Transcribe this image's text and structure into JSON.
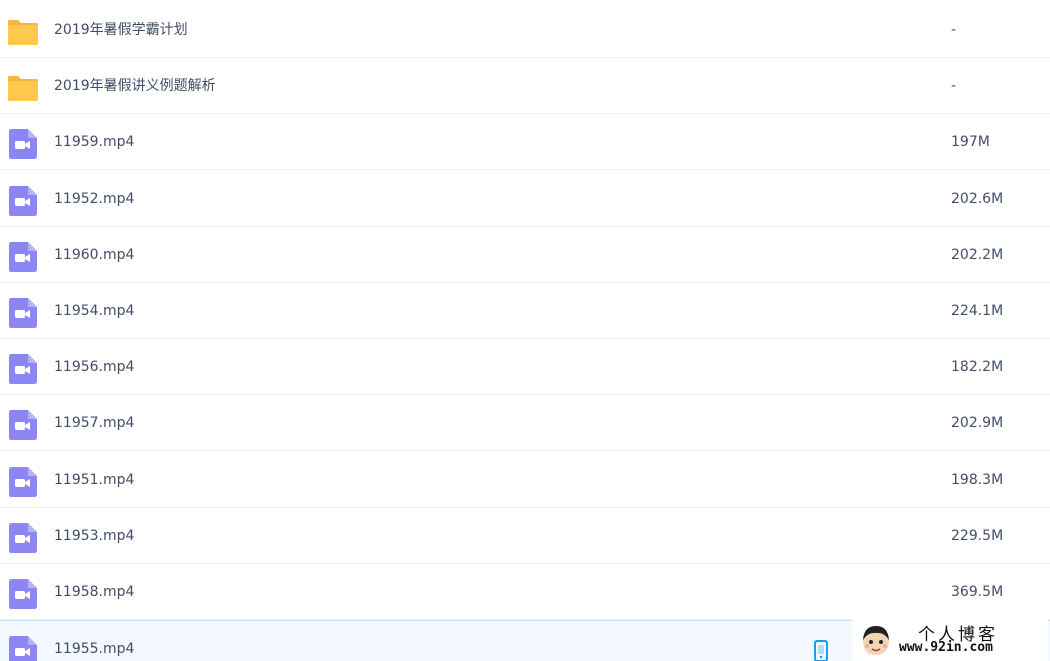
{
  "colors": {
    "folder_icon": "#ffc94d",
    "folder_tab": "#f4b53c",
    "video_icon": "#8b86f1",
    "text": "#424e67",
    "row_divider": "#f1f2f4",
    "hover_bg": "#f3f9fe",
    "accent": "#1e9af2"
  },
  "files": [
    {
      "name": "2019年暑假学霸计划",
      "size": "-",
      "type": "folder",
      "icon": "folder-icon"
    },
    {
      "name": "2019年暑假讲义例题解析",
      "size": "-",
      "type": "folder",
      "icon": "folder-icon"
    },
    {
      "name": "11959.mp4",
      "size": "197M",
      "type": "video",
      "icon": "video-file-icon"
    },
    {
      "name": "11952.mp4",
      "size": "202.6M",
      "type": "video",
      "icon": "video-file-icon"
    },
    {
      "name": "11960.mp4",
      "size": "202.2M",
      "type": "video",
      "icon": "video-file-icon"
    },
    {
      "name": "11954.mp4",
      "size": "224.1M",
      "type": "video",
      "icon": "video-file-icon"
    },
    {
      "name": "11956.mp4",
      "size": "182.2M",
      "type": "video",
      "icon": "video-file-icon"
    },
    {
      "name": "11957.mp4",
      "size": "202.9M",
      "type": "video",
      "icon": "video-file-icon"
    },
    {
      "name": "11951.mp4",
      "size": "198.3M",
      "type": "video",
      "icon": "video-file-icon"
    },
    {
      "name": "11953.mp4",
      "size": "229.5M",
      "type": "video",
      "icon": "video-file-icon"
    },
    {
      "name": "11958.mp4",
      "size": "369.5M",
      "type": "video",
      "icon": "video-file-icon"
    },
    {
      "name": "11955.mp4",
      "size": "",
      "type": "video",
      "icon": "video-file-icon",
      "hovered": true
    }
  ],
  "hover_actions": [
    {
      "name": "phone-icon"
    },
    {
      "name": "download-icon"
    }
  ],
  "watermark": {
    "title": "个人博客",
    "url": "www.92in.com",
    "icon": "mascot-logo"
  }
}
